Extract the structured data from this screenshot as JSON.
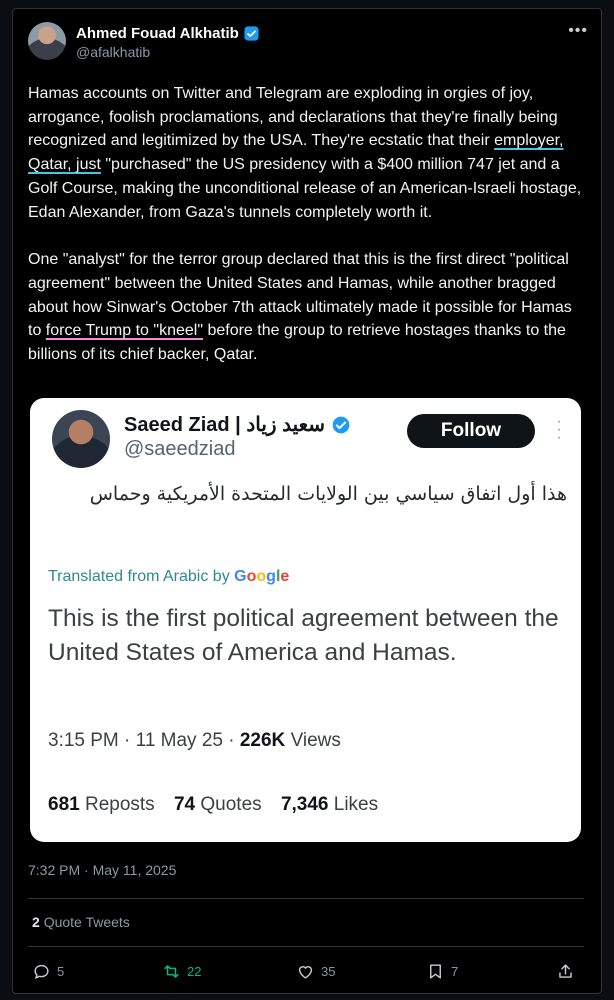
{
  "tweet": {
    "author_name": "Ahmed Fouad Alkhatib",
    "author_handle": "@afalkhatib",
    "more_icon": "more-icon",
    "paragraph1": {
      "before": "Hamas accounts on Twitter and Telegram are exploding in orgies of joy, arrogance, foolish proclamations, and declarations that they're finally being recognized and legitimized by the USA. They're ecstatic that their ",
      "highlight": "employer, Qatar, just",
      "after": " \"purchased\" the US presidency with a $400 million 747 jet and a Golf Course, making the unconditional release of an American-Israeli hostage, Edan Alexander, from Gaza's tunnels completely worth it."
    },
    "paragraph2": {
      "before": "One \"analyst\" for the terror group declared that this is the first direct \"political agreement\" between the United States and Hamas, while another bragged about how Sinwar's October 7th attack ultimately made it possible for Hamas to ",
      "highlight": "force Trump to \"kneel\"",
      "after": " before the group to retrieve hostages thanks to the billions of its chief backer, Qatar."
    },
    "timestamp": "7:32 PM · May 11, 2025",
    "quote_tweets_count": "2",
    "quote_tweets_label": "Quote Tweets",
    "actions": {
      "replies": "5",
      "reposts": "22",
      "likes": "35",
      "bookmarks": "7"
    }
  },
  "quoted": {
    "name": "Saeed Ziad | سعيد زياد",
    "handle": "@saeedziad",
    "follow_label": "Follow",
    "arabic_text": "هذا أول اتفاق سياسي بين الولايات المتحدة الأمريكية وحماس",
    "translated_label": "Translated from Arabic by",
    "google": [
      "G",
      "o",
      "o",
      "g",
      "l",
      "e"
    ],
    "translation": "This is the first political agreement between the United States of America and Hamas.",
    "time": "3:15 PM",
    "date": "11 May 25",
    "views_count": "226K",
    "views_label": "Views",
    "reposts_count": "681",
    "reposts_label": "Reposts",
    "quotes_count": "74",
    "quotes_label": "Quotes",
    "likes_count": "7,346",
    "likes_label": "Likes"
  },
  "colors": {
    "verified": "#1d9bf0",
    "repost_active": "#00ba7c",
    "translated_text": "#2d8a8f"
  }
}
